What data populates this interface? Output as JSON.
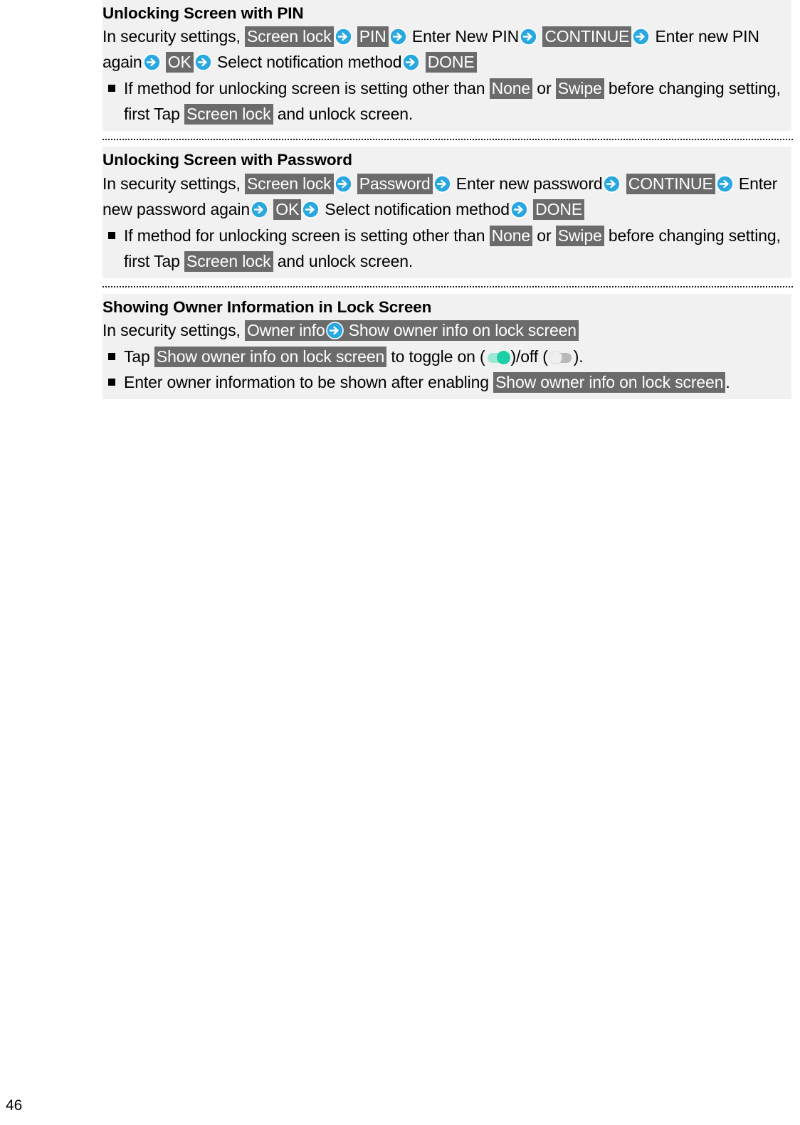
{
  "page": {
    "number": "46",
    "highlight_color": "#6b6b6b",
    "panel_color": "#f1f1f1",
    "arrow_icon_color": "#29a8e0",
    "toggle_on_color": "#1ccfa6",
    "toggle_off_color": "#eeeeee"
  },
  "sections": [
    {
      "title": "Unlocking Screen with PIN",
      "steps_intro": "In security settings,",
      "steps": [
        {
          "label": "Screen lock",
          "highlight": true
        },
        {
          "label": "PIN",
          "highlight": true
        },
        {
          "label": "Enter New PIN",
          "highlight": false
        },
        {
          "label": "CONTINUE",
          "highlight": true
        },
        {
          "label": "Enter new PIN again",
          "highlight": false
        },
        {
          "label": "OK",
          "highlight": true
        },
        {
          "label": "Select notification method",
          "highlight": false
        },
        {
          "label": "DONE",
          "highlight": true
        }
      ],
      "notes": [
        {
          "parts": [
            {
              "text": "If method for unlocking screen is setting other than ",
              "highlight": false
            },
            {
              "text": "None",
              "highlight": true
            },
            {
              "text": " or ",
              "highlight": false
            },
            {
              "text": "Swipe",
              "highlight": true
            },
            {
              "text": " before changing setting, first Tap ",
              "highlight": false
            },
            {
              "text": "Screen lock",
              "highlight": true
            },
            {
              "text": " and unlock screen.",
              "highlight": false
            }
          ]
        }
      ]
    },
    {
      "title": "Unlocking Screen with Password",
      "steps_intro": "In security settings,",
      "steps": [
        {
          "label": "Screen lock",
          "highlight": true
        },
        {
          "label": "Password",
          "highlight": true
        },
        {
          "label": "Enter new password",
          "highlight": false
        },
        {
          "label": "CONTINUE",
          "highlight": true
        },
        {
          "label": "Enter new password again",
          "highlight": false
        },
        {
          "label": "OK",
          "highlight": true
        },
        {
          "label": "Select notification method",
          "highlight": false
        },
        {
          "label": "DONE",
          "highlight": true
        }
      ],
      "notes": [
        {
          "parts": [
            {
              "text": "If method for unlocking screen is setting other than ",
              "highlight": false
            },
            {
              "text": "None",
              "highlight": true
            },
            {
              "text": " or ",
              "highlight": false
            },
            {
              "text": "Swipe",
              "highlight": true
            },
            {
              "text": " before changing setting, first Tap ",
              "highlight": false
            },
            {
              "text": "Screen lock",
              "highlight": true
            },
            {
              "text": " and unlock screen.",
              "highlight": false
            }
          ]
        }
      ]
    },
    {
      "title": "Showing Owner Information in Lock Screen",
      "steps_intro": "In security settings,",
      "steps": [
        {
          "label": "Owner info",
          "highlight": true
        },
        {
          "label": "Show owner info on lock screen",
          "highlight": true
        }
      ],
      "notes": []
    }
  ],
  "owner_notes": {
    "note1": {
      "lead": "Tap ",
      "keyword": "Show owner info on lock screen",
      "mid": " to toggle on (",
      "mid2": ")/off (",
      "tail": ")."
    },
    "note2": {
      "lead": "Enter owner information to be shown after enabling ",
      "keyword": "Show owner info on lock screen",
      "tail": "."
    }
  },
  "icons": {
    "arrow": "blue-circle-right-arrow-icon",
    "toggle_on": "toggle-on-icon",
    "toggle_off": "toggle-off-icon",
    "bullet": "square-bullet-icon"
  }
}
